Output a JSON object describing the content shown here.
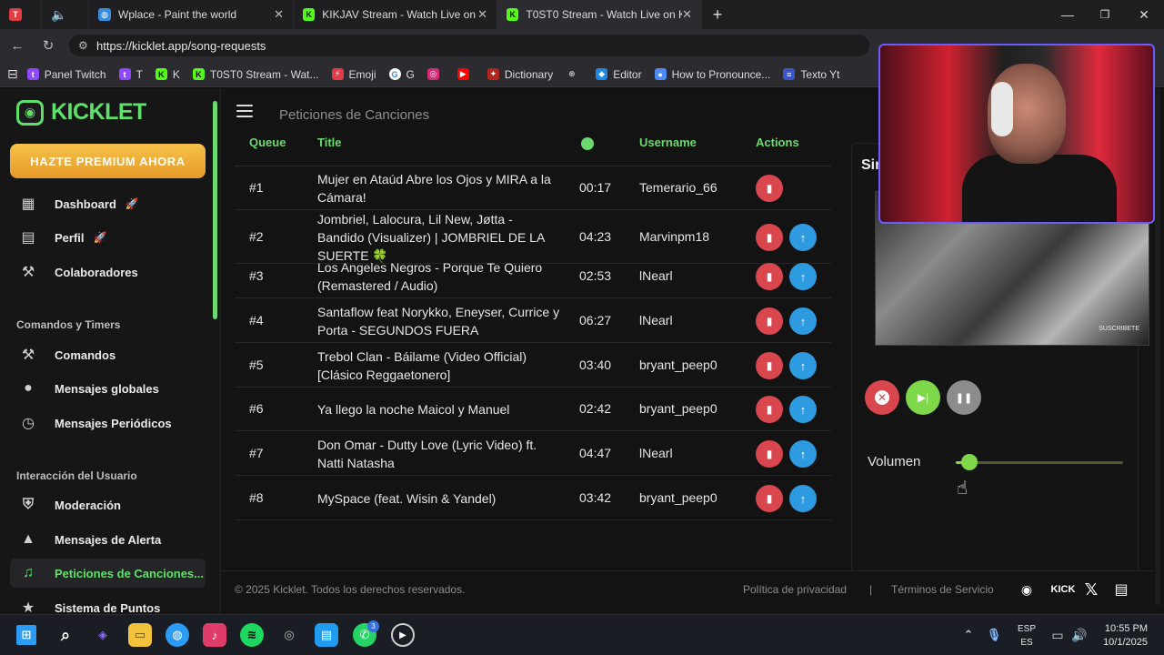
{
  "browser": {
    "tabs": [
      {
        "title": "Wplace - Paint the world",
        "favicon": "globe-icon"
      },
      {
        "title": "KIKJAV Stream - Watch Live on Ki",
        "favicon": "kick-icon"
      },
      {
        "title": "T0ST0 Stream - Watch Live on Ki",
        "favicon": "kick-icon"
      }
    ],
    "url": "https://kicklet.app/song-requests",
    "bookmarks": [
      "Panel Twitch",
      "T",
      "K",
      "T0ST0 Stream - Wat...",
      "Emoji",
      "G",
      "",
      "",
      "Dictionary",
      "",
      "Editor",
      "How to Pronounce...",
      "Texto Yt"
    ]
  },
  "sidebar": {
    "logo": "KICKLET",
    "premium": "HAZTE PREMIUM AHORA",
    "items_top": [
      {
        "label": "Dashboard",
        "icon": "dashboard-icon",
        "badge": "🚀"
      },
      {
        "label": "Perfil",
        "icon": "clipboard-icon",
        "badge": "🚀"
      },
      {
        "label": "Colaboradores",
        "icon": "handshake-icon",
        "badge": ""
      }
    ],
    "section1": "Comandos y Timers",
    "items_mid": [
      {
        "label": "Comandos",
        "icon": "wrench-icon"
      },
      {
        "label": "Mensajes globales",
        "icon": "chat-icon"
      },
      {
        "label": "Mensajes Periódicos",
        "icon": "clock-icon"
      }
    ],
    "section2": "Interacción del Usuario",
    "items_bottom": [
      {
        "label": "Moderación",
        "icon": "shield-icon"
      },
      {
        "label": "Mensajes de Alerta",
        "icon": "warning-icon"
      },
      {
        "label": "Peticiones de Canciones...",
        "icon": "music-icon"
      },
      {
        "label": "Sistema de Puntos",
        "icon": "star-icon"
      }
    ]
  },
  "topbar": {
    "title": "Peticiones de Canciones"
  },
  "queue": {
    "headers": {
      "queue": "Queue",
      "title": "Title",
      "username": "Username",
      "actions": "Actions"
    },
    "rows": [
      {
        "num": "#1",
        "title": "Mujer en Ataúd Abre los Ojos y MIRA a la Cámara!",
        "duration": "00:17",
        "user": "Temerario_66",
        "promote": false
      },
      {
        "num": "#2",
        "title": "Jombriel, Lalocura, Lil New, Jøtta - Bandido (Visualizer) | JOMBRIEL DE LA SUERTE 🍀",
        "duration": "04:23",
        "user": "Marvinpm18",
        "promote": true
      },
      {
        "num": "#3",
        "title": "Los Angeles Negros - Porque Te Quiero (Remastered / Audio)",
        "duration": "02:53",
        "user": "lNearl",
        "promote": true
      },
      {
        "num": "#4",
        "title": "Santaflow feat Norykko, Eneyser, Currice y Porta - SEGUNDOS FUERA",
        "duration": "06:27",
        "user": "lNearl",
        "promote": true
      },
      {
        "num": "#5",
        "title": "Trebol Clan - Báilame (Video Official) [Clásico Reggaetonero]",
        "duration": "03:40",
        "user": "bryant_peep0",
        "promote": true
      },
      {
        "num": "#6",
        "title": "Ya llego la noche Maicol y Manuel",
        "duration": "02:42",
        "user": "bryant_peep0",
        "promote": true
      },
      {
        "num": "#7",
        "title": "Don Omar - Dutty Love (Lyric Video) ft. Natti Natasha",
        "duration": "04:47",
        "user": "lNearl",
        "promote": true
      },
      {
        "num": "#8",
        "title": "MySpace (feat. Wisin & Yandel)",
        "duration": "03:42",
        "user": "bryant_peep0",
        "promote": true
      }
    ]
  },
  "player": {
    "label": "Sin",
    "video_watermark": "SUSCRIBETE",
    "volume_label": "Volumen",
    "volume_fraction": 0.08
  },
  "footer": {
    "copyright": "© 2025 Kicklet. Todos los derechos reservados.",
    "privacy": "Política de privacidad",
    "separator": "|",
    "terms": "Términos de Servicio",
    "kick": "KICK"
  },
  "taskbar": {
    "lang1": "ESP",
    "lang2": "ES",
    "time": "10:55 PM",
    "date": "10/1/2025",
    "whatsapp_badge": "3"
  }
}
